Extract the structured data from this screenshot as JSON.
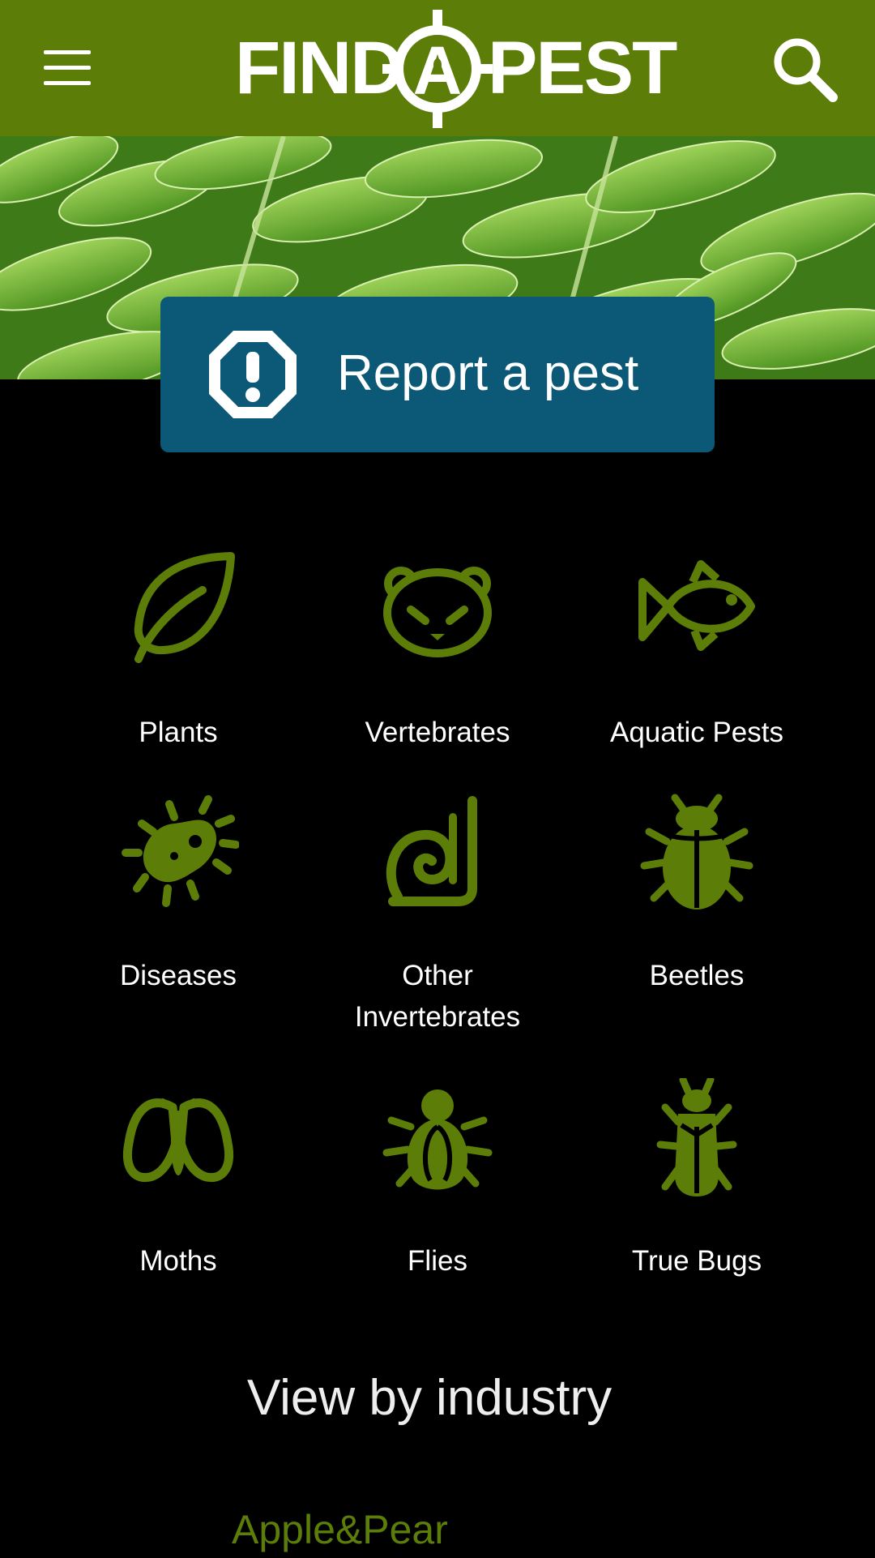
{
  "header": {
    "logo_left": "FIND",
    "logo_right": "PEST",
    "logo_middle_letter": "A",
    "menu_icon": "hamburger-menu-icon",
    "search_icon": "search-icon",
    "background_color": "#5c7d07"
  },
  "hero": {
    "image": "fern-leaves"
  },
  "report": {
    "label": "Report a pest",
    "icon": "alert-octagon-icon",
    "background_color": "#0b5877"
  },
  "categories": [
    {
      "label": "Plants",
      "icon": "leaf-icon"
    },
    {
      "label": "Vertebrates",
      "icon": "animal-face-icon"
    },
    {
      "label": "Aquatic Pests",
      "icon": "fish-icon"
    },
    {
      "label": "Diseases",
      "icon": "bacterium-icon"
    },
    {
      "label": "Other\nInvertebrates",
      "icon": "snail-icon"
    },
    {
      "label": "Beetles",
      "icon": "beetle-icon"
    },
    {
      "label": "Moths",
      "icon": "moth-icon"
    },
    {
      "label": "Flies",
      "icon": "fly-icon"
    },
    {
      "label": "True Bugs",
      "icon": "true-bug-icon"
    }
  ],
  "industry": {
    "title": "View by industry",
    "items": [
      "Apple&Pear"
    ]
  },
  "colors": {
    "accent_green": "#5c7d07",
    "report_blue": "#0b5877",
    "background": "#000000"
  }
}
